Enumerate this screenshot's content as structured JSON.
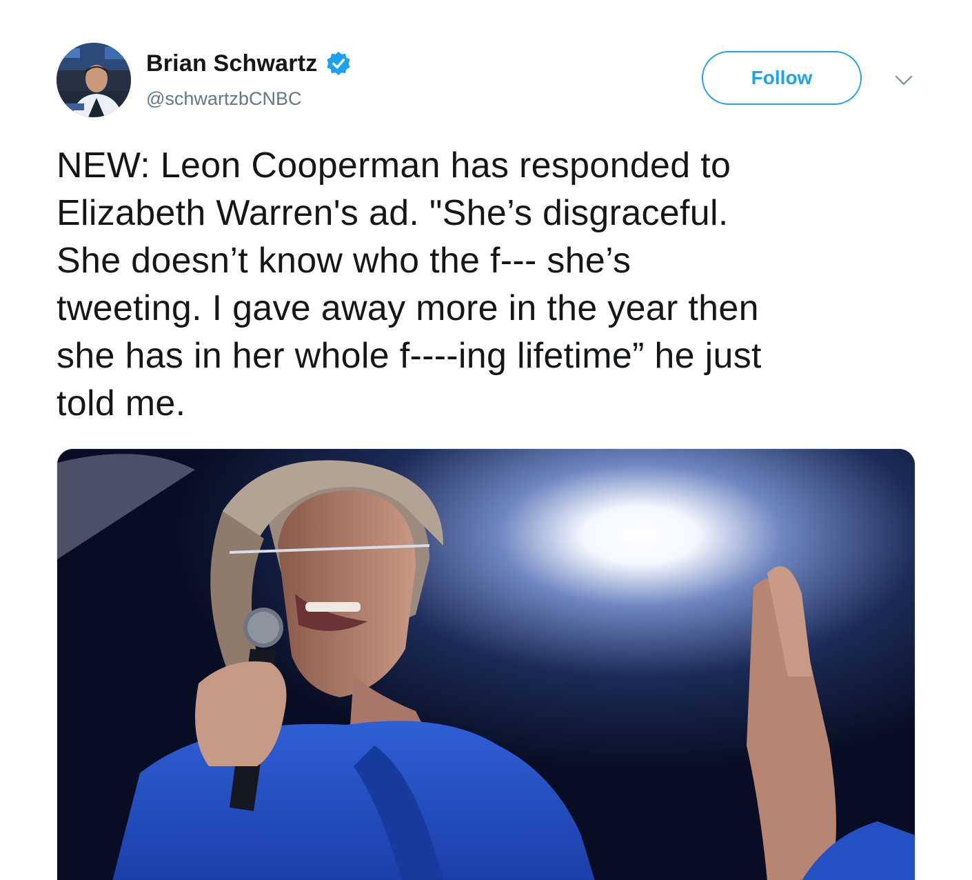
{
  "user": {
    "display_name": "Brian Schwartz",
    "handle": "@schwartzbCNBC",
    "verified": true,
    "avatar_icon": "profile-photo"
  },
  "actions": {
    "follow_label": "Follow",
    "more_icon": "chevron-down-icon"
  },
  "tweet": {
    "lines": [
      "NEW: Leon Cooperman has responded to",
      "Elizabeth Warren's ad. \"She’s disgraceful.",
      "She doesn’t know who the f--- she’s",
      "tweeting. I gave away more in the year then",
      "she has in her whole f----ing lifetime” he just",
      "told me."
    ]
  },
  "colors": {
    "accent": "#1da1f2",
    "handle_gray": "#657786",
    "text": "#14171a"
  }
}
